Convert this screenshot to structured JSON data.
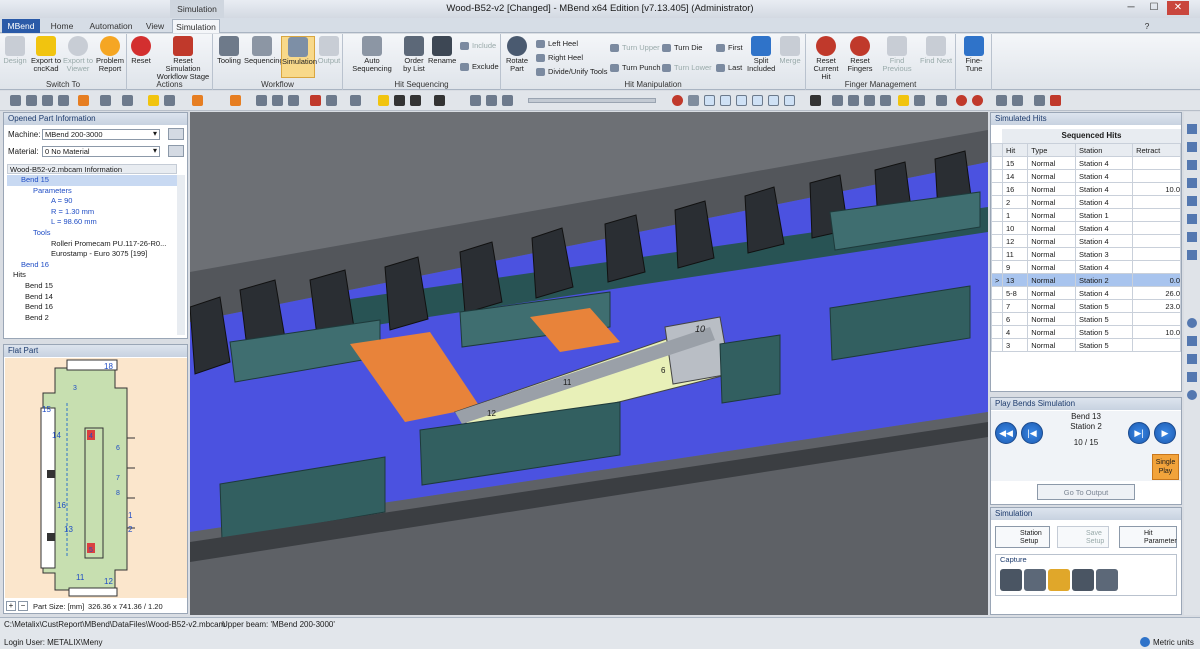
{
  "window": {
    "title": "Wood-B52-v2 [Changed] - MBend x64 Edition [v7.13.405] (Administrator)",
    "context_tab": "Simulation"
  },
  "tabs": [
    "MBend",
    "Home",
    "Automation",
    "View",
    "Simulation"
  ],
  "ribbon": {
    "switch_to": {
      "label": "Switch To",
      "buttons": [
        "Design",
        "Export to cncKad",
        "Export to Viewer",
        "Problem Report"
      ]
    },
    "actions": {
      "label": "Actions",
      "buttons": [
        "Reset",
        "Reset Simulation Workflow Stage"
      ]
    },
    "workflow": {
      "label": "Workflow",
      "buttons": [
        "Tooling",
        "Sequencing",
        "Simulation",
        "Output"
      ]
    },
    "hit_sequencing": {
      "label": "Hit Sequencing",
      "buttons": [
        "Auto Sequencing",
        "Order by List",
        "Rename"
      ],
      "small": [
        "Include",
        "Exclude"
      ]
    },
    "hit_manipulation": {
      "label": "Hit Manipulation",
      "buttons": [
        "Rotate Part"
      ],
      "small": [
        "Left Heel",
        "Right Heel",
        "Divide/Unify Tools",
        "Turn Upper",
        "Turn Punch",
        "Turn Die",
        "Turn Lower",
        "First",
        "Last"
      ],
      "buttons2": [
        "Split Included",
        "Merge"
      ]
    },
    "finger_management": {
      "label": "Finger Management",
      "buttons": [
        "Reset Current Hit",
        "Reset Fingers",
        "Find Previous",
        "Find Next"
      ]
    },
    "fine_tune": {
      "buttons": [
        "Fine-Tune"
      ]
    }
  },
  "left_panel": {
    "title": "Opened Part Information",
    "machine_label": "Machine:",
    "machine_value": "MBend 200-3000",
    "material_label": "Material:",
    "material_value": "0 No Material",
    "tree_header": "Wood-B52-v2.mbcam Information",
    "tree": [
      "Bend 15",
      "Parameters",
      "A = 90",
      "R = 1.30 mm",
      "L = 98.60 mm",
      "Tools",
      "Rolleri Promecam PU.117-26-R0...",
      "Eurostamp - Euro 3075 [199]",
      "Bend 16",
      "Hits",
      "Bend 15",
      "Bend 14",
      "Bend 16",
      "Bend 2"
    ]
  },
  "flat_part": {
    "title": "Flat Part",
    "labels": [
      "18",
      "15",
      "14",
      "16",
      "13",
      "11",
      "12",
      "1",
      "2",
      "3",
      "4",
      "5",
      "6",
      "7",
      "8"
    ],
    "part_size_label": "Part Size: [mm]",
    "part_size_value": "326.36 x 741.36 / 1.20"
  },
  "viewport": {
    "labels": [
      "10",
      "11",
      "12",
      "6"
    ]
  },
  "simulated_hits": {
    "title": "Simulated Hits",
    "subtitle": "Sequenced Hits",
    "columns": [
      "Hit",
      "Type",
      "Station",
      "Retract"
    ],
    "rows": [
      [
        "15",
        "Normal",
        "Station 4",
        ""
      ],
      [
        "14",
        "Normal",
        "Station 4",
        ""
      ],
      [
        "16",
        "Normal",
        "Station 4",
        "10.0"
      ],
      [
        "2",
        "Normal",
        "Station 4",
        ""
      ],
      [
        "1",
        "Normal",
        "Station 1",
        ""
      ],
      [
        "10",
        "Normal",
        "Station 4",
        ""
      ],
      [
        "12",
        "Normal",
        "Station 4",
        ""
      ],
      [
        "11",
        "Normal",
        "Station 3",
        ""
      ],
      [
        "9",
        "Normal",
        "Station 4",
        ""
      ],
      [
        "13",
        "Normal",
        "Station 2",
        "0.0"
      ],
      [
        "5-8",
        "Normal",
        "Station 4",
        "26.0"
      ],
      [
        "7",
        "Normal",
        "Station 5",
        "23.0"
      ],
      [
        "6",
        "Normal",
        "Station 5",
        ""
      ],
      [
        "4",
        "Normal",
        "Station 5",
        "10.0"
      ],
      [
        "3",
        "Normal",
        "Station 5",
        ""
      ]
    ],
    "selected_index": 9
  },
  "play": {
    "title": "Play Bends Simulation",
    "bend": "Bend 13",
    "station": "Station 2",
    "progress": "10 / 15",
    "single_play": "Single Play",
    "go_output": "Go To Output"
  },
  "simulation": {
    "title": "Simulation",
    "buttons": [
      "Station Setup",
      "Save Setup",
      "Hit Parameter"
    ],
    "capture": "Capture"
  },
  "status": {
    "path": "C:\\Metalix\\CustReport\\MBend\\DataFiles\\Wood-B52-v2.mbcam",
    "beam": "Upper beam: 'MBend 200-3000'",
    "user": "Login User: METALIX\\Meny",
    "units": "Metric units"
  }
}
